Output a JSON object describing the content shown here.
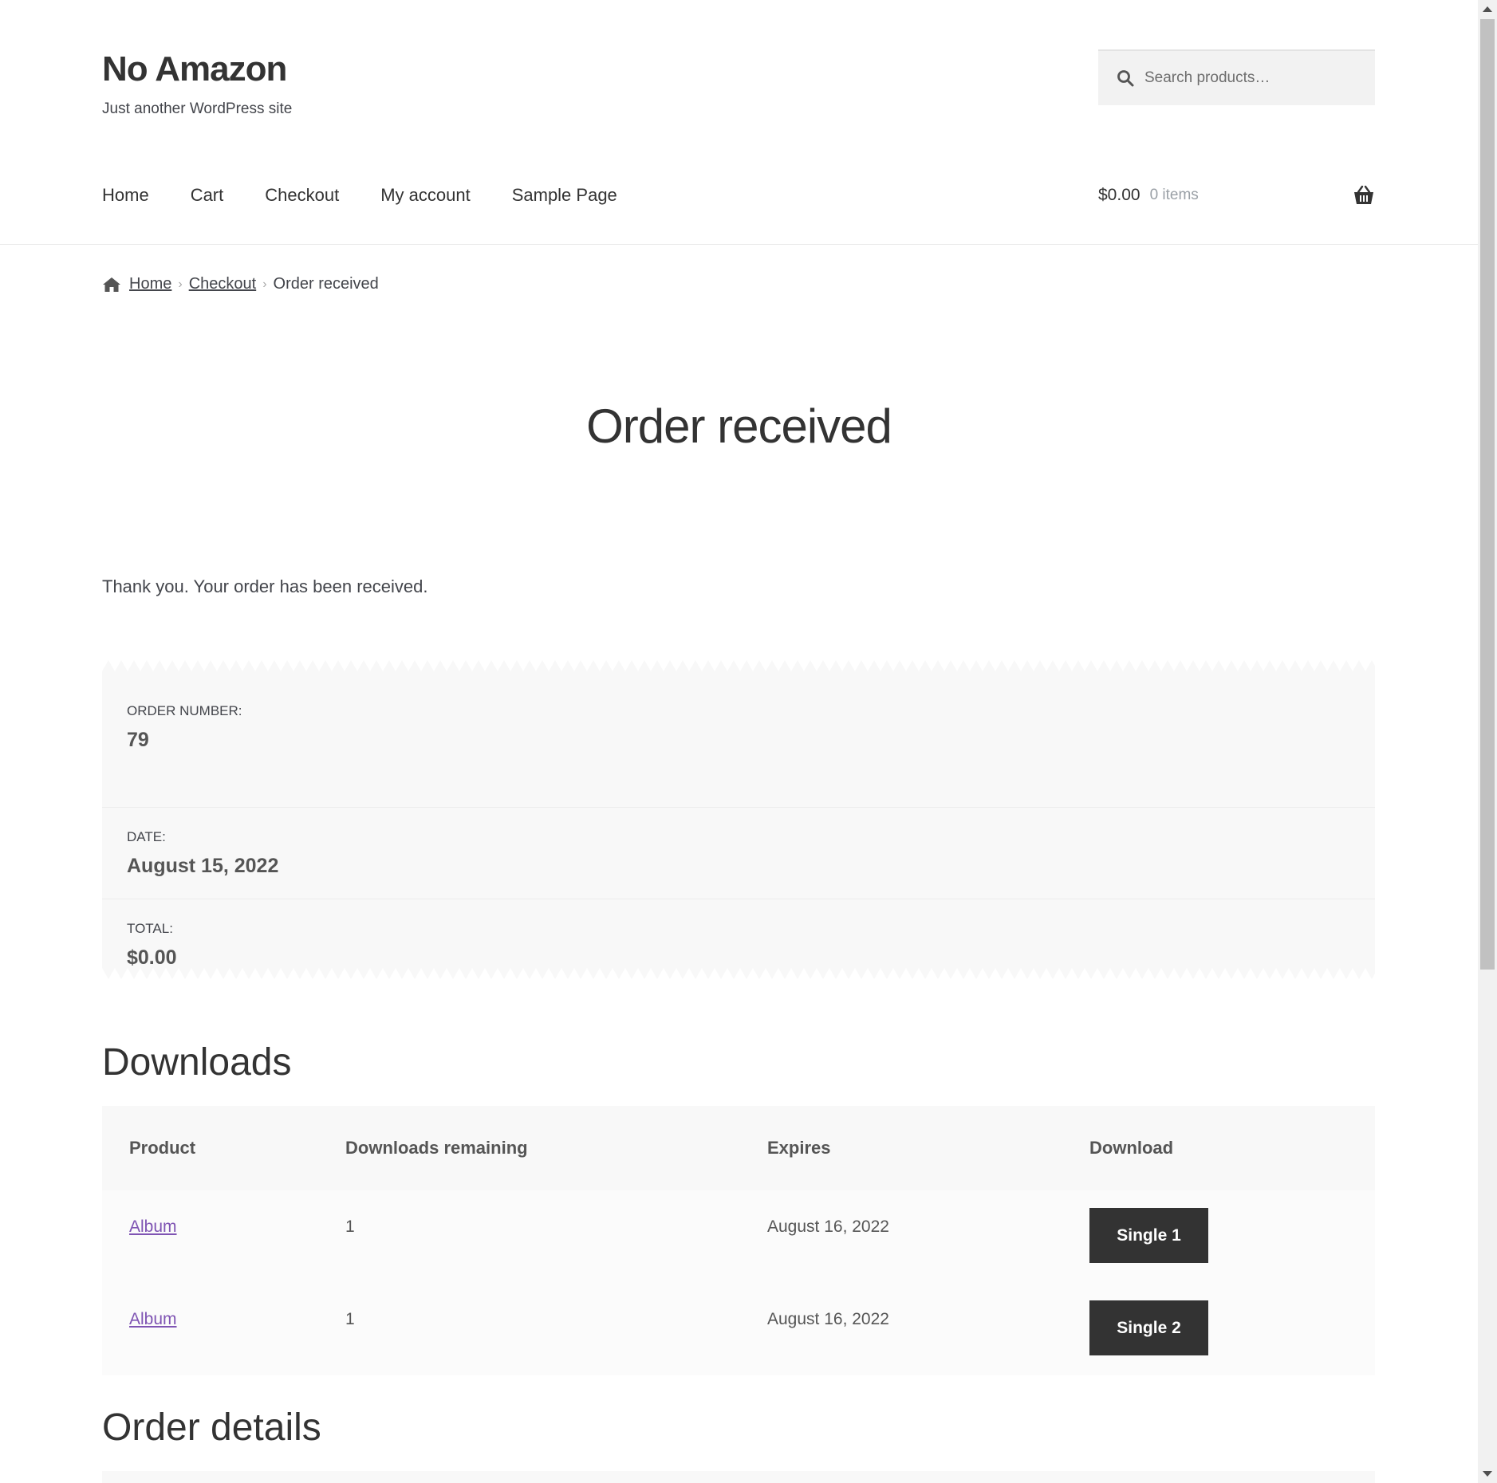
{
  "site": {
    "title": "No Amazon",
    "description": "Just another WordPress site"
  },
  "search": {
    "placeholder": "Search products…"
  },
  "nav": {
    "items": [
      "Home",
      "Cart",
      "Checkout",
      "My account",
      "Sample Page"
    ]
  },
  "cart": {
    "amount": "$0.00",
    "count": "0 items"
  },
  "breadcrumb": {
    "home": "Home",
    "checkout": "Checkout",
    "current": "Order received"
  },
  "page": {
    "title": "Order received",
    "thanks": "Thank you. Your order has been received."
  },
  "overview": {
    "order_number_label": "Order number:",
    "order_number": "79",
    "date_label": "Date:",
    "date": "August 15, 2022",
    "total_label": "Total:",
    "total": "$0.00"
  },
  "downloads": {
    "title": "Downloads",
    "headers": [
      "Product",
      "Downloads remaining",
      "Expires",
      "Download"
    ],
    "rows": [
      {
        "product": "Album",
        "remaining": "1",
        "expires": "August 16, 2022",
        "button": "Single 1"
      },
      {
        "product": "Album",
        "remaining": "1",
        "expires": "August 16, 2022",
        "button": "Single 2"
      }
    ]
  },
  "order_details": {
    "title": "Order details"
  },
  "colors": {
    "link_purple": "#7f54b3",
    "button_dark": "#333333",
    "panel_bg": "#f8f8f8"
  }
}
